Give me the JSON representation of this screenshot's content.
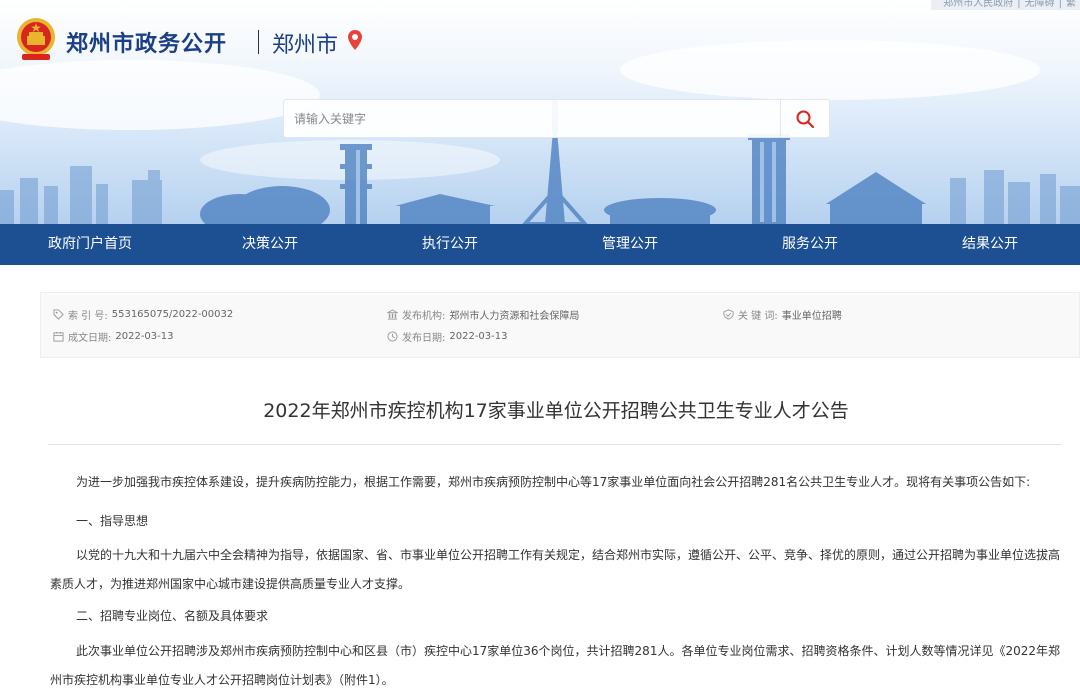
{
  "header": {
    "top_links": [
      "郑州市人民政府",
      "无障碍",
      "繁"
    ],
    "site_name": "郑州市政务公开",
    "city_name": "郑州市",
    "colors": {
      "brand": "#1b3f86",
      "nav": "#1d4f93",
      "emblem": "#d8261e"
    }
  },
  "search": {
    "placeholder": "请输入关键字",
    "icon": "search-icon"
  },
  "nav": {
    "items": [
      "政府门户首页",
      "决策公开",
      "执行公开",
      "管理公开",
      "服务公开",
      "结果公开"
    ]
  },
  "info": {
    "index_label": "索 引 号:",
    "index_value": "553165075/2022-00032",
    "publisher_label": "发布机构:",
    "publisher_value": "郑州市人力资源和社会保障局",
    "keyword_label": "关 键 词:",
    "keyword_value": "事业单位招聘",
    "written_label": "成文日期:",
    "written_value": "2022-03-13",
    "released_label": "发布日期:",
    "released_value": "2022-03-13"
  },
  "article": {
    "title": "2022年郑州市疾控机构17家事业单位公开招聘公共卫生专业人才公告",
    "p1": "为进一步加强我市疾控体系建设，提升疾病防控能力，根据工作需要，郑州市疾病预防控制中心等17家事业单位面向社会公开招聘281名公共卫生专业人才。现将有关事项公告如下:",
    "h1": "一、指导思想",
    "p2": "以党的十九大和十九届六中全会精神为指导，依据国家、省、市事业单位公开招聘工作有关规定，结合郑州市实际，遵循公开、公平、竞争、择优的原则，通过公开招聘为事业单位选拔高素质人才，为推进郑州国家中心城市建设提供高质量专业人才支撑。",
    "h2": "二、招聘专业岗位、名额及具体要求",
    "p3": "此次事业单位公开招聘涉及郑州市疾病预防控制中心和区县（市）疾控中心17家单位36个岗位，共计招聘281人。各单位专业岗位需求、招聘资格条件、计划人数等情况详见《2022年郑州市疾控机构事业单位专业人才公开招聘岗位计划表》（附件1）。"
  }
}
